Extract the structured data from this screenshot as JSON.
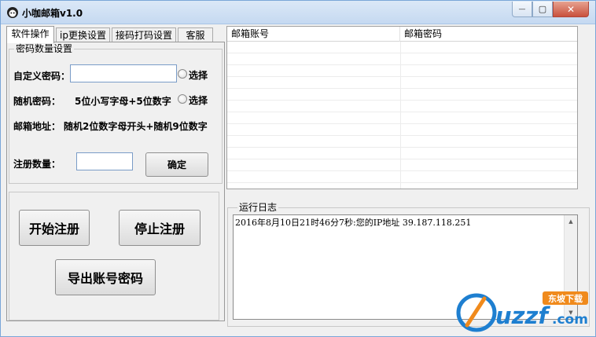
{
  "window": {
    "title": "小咖邮箱v1.0",
    "minimize_glyph": "—",
    "maximize_glyph": "▢",
    "close_glyph": "✕"
  },
  "tabs": [
    {
      "label": "软件操作",
      "active": true
    },
    {
      "label": "ip更换设置",
      "active": false
    },
    {
      "label": "接码打码设置",
      "active": false
    },
    {
      "label": "客服",
      "active": false
    }
  ],
  "password_group": {
    "legend": "密码数量设置",
    "custom_label": "自定义密码：",
    "custom_value": "",
    "custom_radio_label": "选择",
    "random_label": "随机密码：",
    "random_desc": "5位小写字母+5位数字",
    "random_radio_label": "选择",
    "email_label": "邮箱地址：",
    "email_desc": "随机2位数字母开头+随机9位数字",
    "count_label": "注册数量：",
    "count_value": "",
    "confirm_label": "确定"
  },
  "actions": {
    "start_label": "开始注册",
    "stop_label": "停止注册",
    "export_label": "导出账号密码"
  },
  "table": {
    "columns": [
      "邮箱账号",
      "邮箱密码"
    ],
    "rows": []
  },
  "log": {
    "legend": "运行日志",
    "lines": [
      "2016年8月10日21时46分7秒:您的IP地址 39.187.118.251"
    ]
  },
  "watermark": {
    "text": "uzzf",
    "suffix": ".com",
    "badge": "东坡下载"
  },
  "colors": {
    "titlebar": "#c5d9f1",
    "close_button": "#c9513d",
    "watermark_blue": "#1e7fd0",
    "watermark_orange": "#f08a1c"
  }
}
